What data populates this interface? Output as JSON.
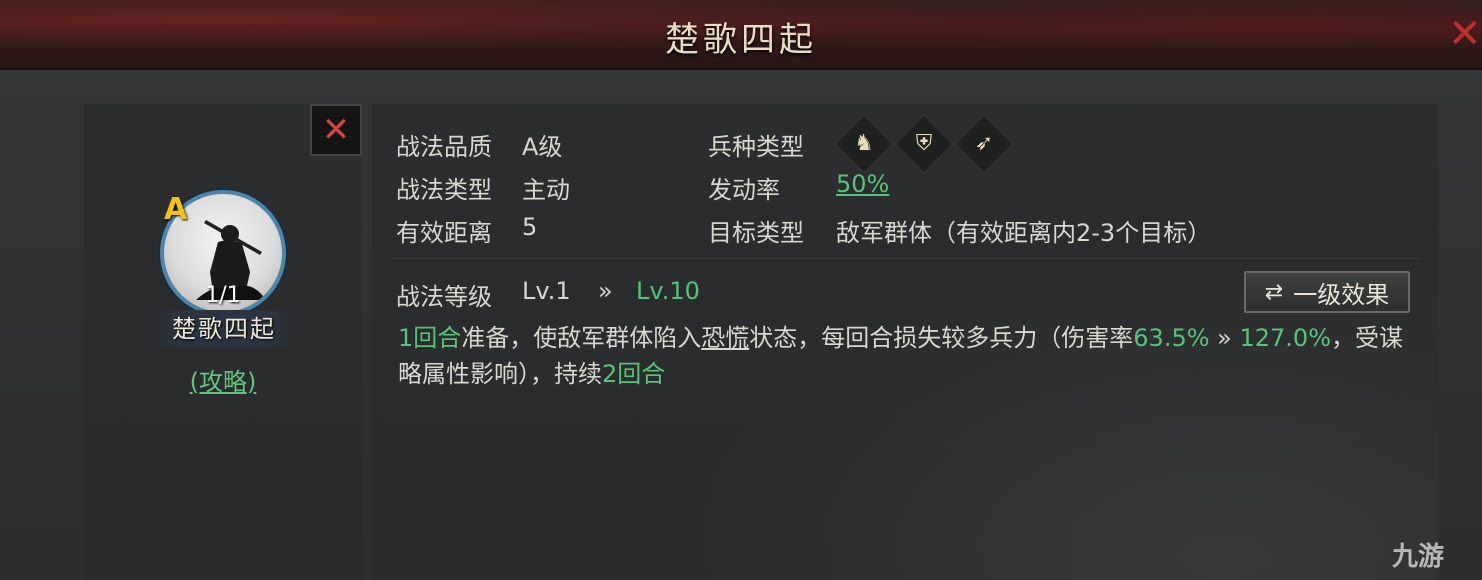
{
  "title": "楚歌四起",
  "close_icon": "close-icon",
  "skill": {
    "grade": "A",
    "count": "1/1",
    "name": "楚歌四起",
    "guide_link": "(攻略)"
  },
  "info": {
    "quality_label": "战法品质",
    "quality_value": "A级",
    "type_label": "战法类型",
    "type_value": "主动",
    "range_label": "有效距离",
    "range_value": "5",
    "troop_label": "兵种类型",
    "troop_icons": [
      "cavalry-icon",
      "shield-icon",
      "archer-icon"
    ],
    "rate_label": "发动率",
    "rate_value": "50%",
    "target_label": "目标类型",
    "target_value": "敌军群体（有效距离内2-3个目标）"
  },
  "level": {
    "label": "战法等级",
    "from": "Lv.1",
    "arrow": "»",
    "to": "Lv.10",
    "effect_button": "一级效果"
  },
  "description": {
    "p1": "1回合",
    "p2": "准备，使敌军群体陷入",
    "p3": "恐慌",
    "p4": "状态，每回合损失较多兵力（伤害率",
    "p5": "63.5%",
    "p6": " » ",
    "p7": "127.0%",
    "p8": "，受谋略属性影响），持续",
    "p9": "2回合"
  },
  "watermark": "九游",
  "colors": {
    "accent_green": "#58c27a",
    "close_red": "#b8322f",
    "grade_gold": "#f2c11a"
  }
}
